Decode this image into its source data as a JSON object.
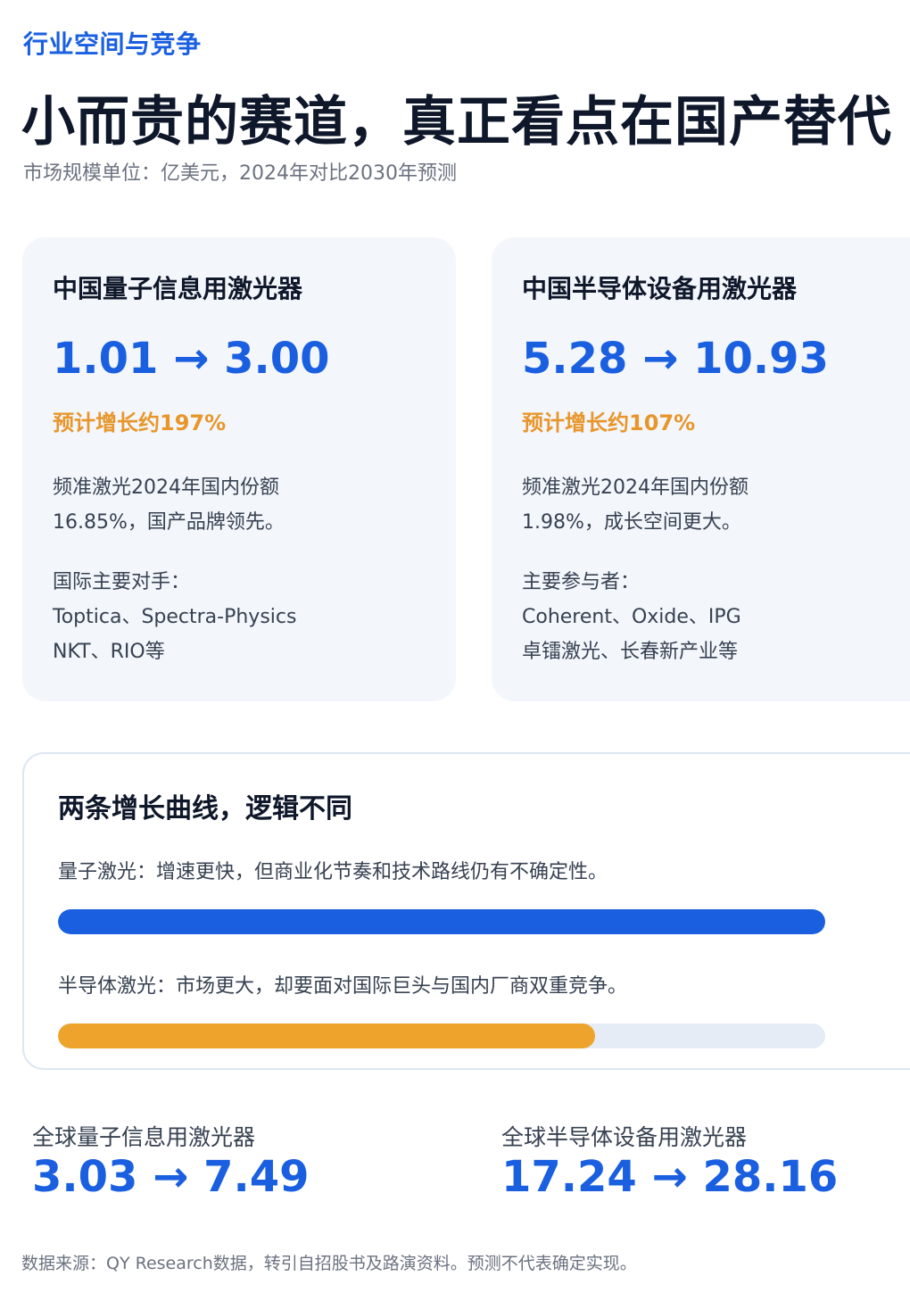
{
  "header": {
    "section_tag": "行业空间与竞争",
    "headline": "小而贵的赛道，真正看点在国产替代",
    "subtitle": "市场规模单位：亿美元，2024年对比2030年预测"
  },
  "cards": [
    {
      "title": "中国量子信息用激光器",
      "range": "1.01 → 3.00",
      "growth": "预计增长约197%",
      "share_line1": "频准激光2024年国内份额",
      "share_line2": "16.85%，国产品牌领先。",
      "players_label": "国际主要对手：",
      "players_line1": "Toptica、Spectra-Physics",
      "players_line2": "NKT、RIO等"
    },
    {
      "title": "中国半导体设备用激光器",
      "range": "5.28 → 10.93",
      "growth": "预计增长约107%",
      "share_line1": "频准激光2024年国内份额",
      "share_line2": "1.98%，成长空间更大。",
      "players_label": "主要参与者：",
      "players_line1": "Coherent、Oxide、IPG",
      "players_line2": "卓镭激光、长春新产业等"
    }
  ],
  "curves": {
    "title": "两条增长曲线，逻辑不同",
    "quantum_text": "量子激光：增速更快，但商业化节奏和技术路线仍有不确定性。",
    "quantum_bar_fraction": 1.0,
    "semi_text": "半导体激光：市场更大，却要面对国际巨头与国内厂商双重竞争。",
    "semi_bar_fraction": 0.7,
    "colors": {
      "quantum": "#1a5fe0",
      "semi": "#eea42c",
      "track": "#e6ecf5"
    }
  },
  "global": [
    {
      "label": "全球量子信息用激光器",
      "range": "3.03 → 7.49"
    },
    {
      "label": "全球半导体设备用激光器",
      "range": "17.24 → 28.16"
    }
  ],
  "source": "数据来源：QY Research数据，转引自招股书及路演资料。预测不代表确定实现。",
  "colors": {
    "accent": "#1a5fe0",
    "growth": "#e8962a",
    "card_bg": "#f3f6fb"
  }
}
